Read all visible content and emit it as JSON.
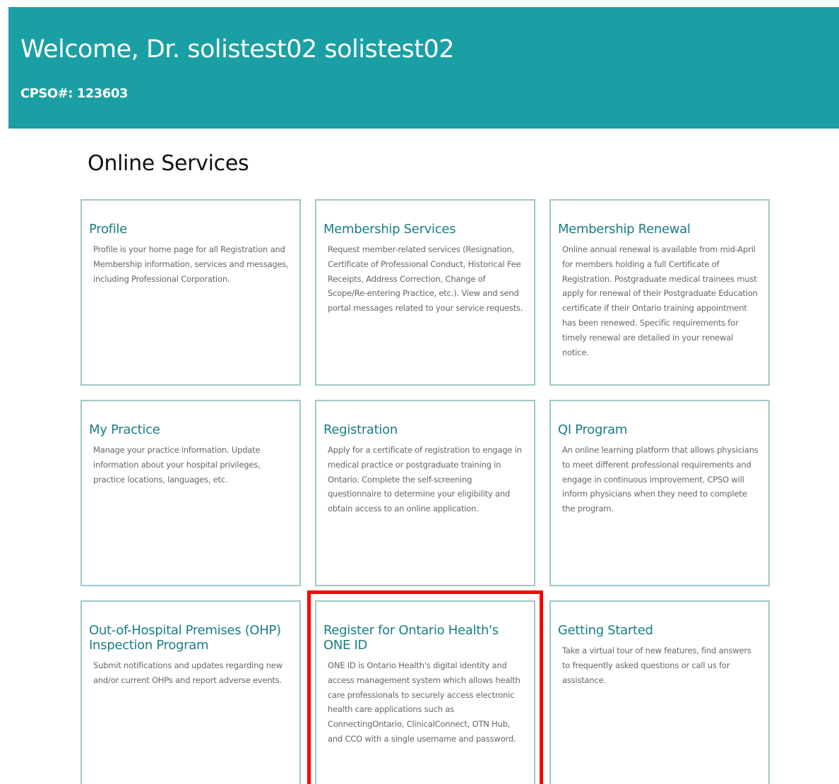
{
  "header": {
    "welcome": "Welcome, Dr. solistest02 solistest02",
    "cpso": "CPSO#: 123603",
    "bg_color": "#1aa0a4"
  },
  "main": {
    "title": "Online Services",
    "cards": [
      {
        "title": "Profile",
        "description": "Profile is your home page for all Registration and Membership information, services and messages, including Professional Corporation."
      },
      {
        "title": "Membership Services",
        "description": "Request member-related services (Resignation, Certificate of Professional Conduct, Historical Fee Receipts, Address Correction, Change of Scope/Re-entering Practice, etc.). View and send portal messages related to your service requests."
      },
      {
        "title": "Membership Renewal",
        "description": "Online annual renewal is available from mid-April for members holding a full Certificate of Registration. Postgraduate medical trainees must apply for renewal of their Postgraduate Education certificate if their Ontario training appointment has been renewed. Specific requirements for timely renewal are detailed in your renewal notice."
      },
      {
        "title": "My Practice",
        "description": "Manage your practice information. Update information about your hospital privileges, practice locations, languages, etc."
      },
      {
        "title": "Registration",
        "description": "Apply for a certificate of registration to engage in medical practice or postgraduate training in Ontario. Complete the self-screening questionnaire to determine your eligibility and obtain access to an online application."
      },
      {
        "title": "QI Program",
        "description": "An online learning platform that allows physicians to meet different professional requirements and engage in continuous improvement. CPSO will inform physicians when they need to complete the program."
      },
      {
        "title": "Out-of-Hospital Premises (OHP) Inspection Program",
        "description": "Submit notifications and updates regarding new and/or current OHPs and report adverse events."
      },
      {
        "title": "Register for Ontario Health's ONE ID",
        "description": "ONE ID is Ontario Health's digital identity and access management system which allows health care professionals to securely access electronic health care applications such as ConnectingOntario, ClinicalConnect, OTN Hub, and CCO with a single username and password."
      },
      {
        "title": "Getting Started",
        "description": "Take a virtual tour of new features, find answers to frequently asked questions or call us for assistance."
      }
    ]
  },
  "colors": {
    "card_title": "#1a7d85",
    "card_border": "#9fc8c7",
    "highlight": "#ff0000"
  }
}
